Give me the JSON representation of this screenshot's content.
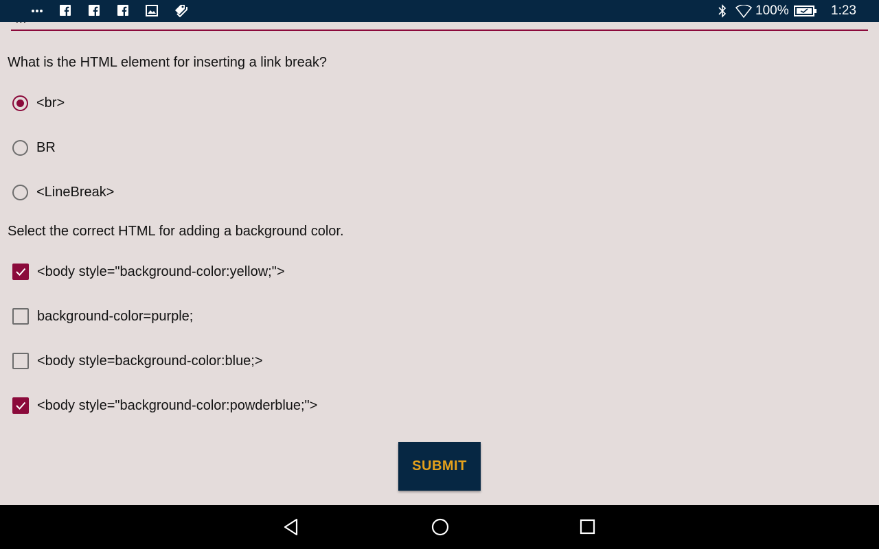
{
  "status_bar": {
    "battery": "100%",
    "time": "1:23",
    "icons": [
      "more-dots-icon",
      "facebook-icon",
      "facebook-icon",
      "facebook-icon",
      "image-icon",
      "tag-icon",
      "bluetooth-icon",
      "wifi-icon",
      "battery-icon"
    ]
  },
  "quiz": {
    "cut_off_title": "...",
    "q1": {
      "text": "What is the HTML element for inserting a link break?",
      "options": [
        {
          "label": "<br>",
          "selected": true
        },
        {
          "label": "BR",
          "selected": false
        },
        {
          "label": "<LineBreak>",
          "selected": false
        }
      ]
    },
    "q2": {
      "text": "Select the correct HTML for adding a background color.",
      "options": [
        {
          "label": "<body style=\"background-color:yellow;\">",
          "checked": true
        },
        {
          "label": "background-color=purple;",
          "checked": false
        },
        {
          "label": "<body style=background-color:blue;>",
          "checked": false
        },
        {
          "label": "<body style=\"background-color:powderblue;\">",
          "checked": true
        }
      ]
    },
    "submit_label": "SUBMIT"
  },
  "nav": {
    "icons": [
      "back-icon",
      "home-icon",
      "recents-icon"
    ]
  },
  "colors": {
    "accent": "#8b0a3b",
    "status_bar": "#062743",
    "background": "#e4dcdb",
    "submit_text": "#e5a11b"
  }
}
